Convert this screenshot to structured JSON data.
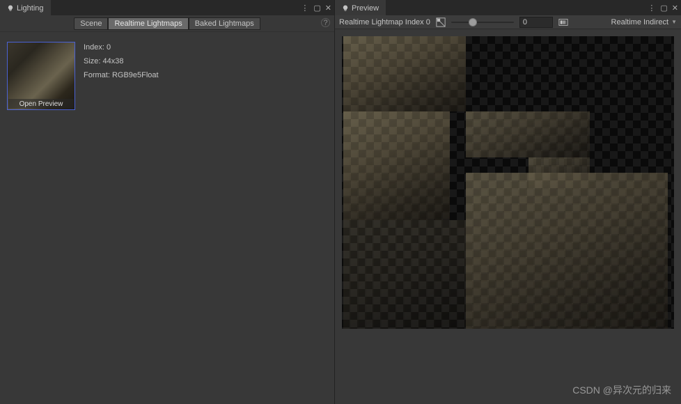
{
  "lighting_panel": {
    "title": "Lighting",
    "tabs": [
      "Scene",
      "Realtime Lightmaps",
      "Baked Lightmaps"
    ],
    "active_tab": "Realtime Lightmaps",
    "thumbnail": {
      "open_label": "Open Preview"
    },
    "info": {
      "index_label": "Index: 0",
      "size_label": "Size: 44x38",
      "format_label": "Format: RGB9e5Float"
    }
  },
  "preview_panel": {
    "title": "Preview",
    "header": {
      "title_text": "Realtime Lightmap Index 0",
      "slider_value": 0.35,
      "numeric_value": "0",
      "mode_label": "Realtime Indirect"
    }
  },
  "watermark": "CSDN @异次元的归来"
}
